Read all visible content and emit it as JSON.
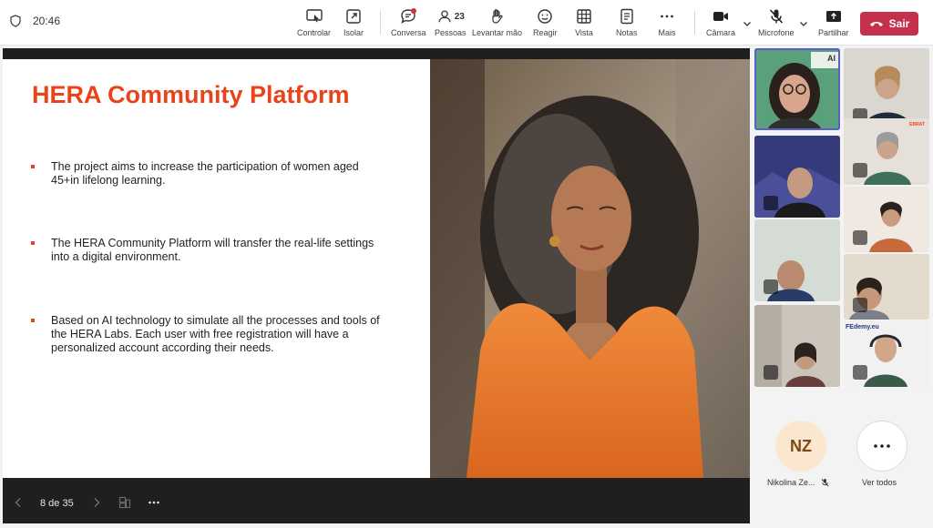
{
  "header": {
    "time": "20:46",
    "buttons": [
      {
        "label": "Controlar",
        "icon": "share-control-icon"
      },
      {
        "label": "Isolar",
        "icon": "pop-out-icon"
      },
      {
        "label": "Conversa",
        "icon": "chat-icon"
      },
      {
        "label": "Pessoas",
        "icon": "people-icon"
      },
      {
        "label": "Levantar mão",
        "icon": "raise-hand-icon"
      },
      {
        "label": "Reagir",
        "icon": "react-icon"
      },
      {
        "label": "Vista",
        "icon": "view-icon"
      },
      {
        "label": "Notas",
        "icon": "notes-icon"
      },
      {
        "label": "Mais",
        "icon": "more-icon"
      },
      {
        "label": "Câmara",
        "icon": "camera-icon"
      },
      {
        "label": "Microfone",
        "icon": "mic-off-icon"
      },
      {
        "label": "Partilhar",
        "icon": "share-icon"
      }
    ],
    "people_count": "23",
    "leave_label": "Sair",
    "colors": {
      "leave": "#c4314b",
      "accent": "#5b5fc7"
    }
  },
  "slide": {
    "title": "HERA Community Platform",
    "bullets": [
      "The project aims to increase the participation of women aged 45+in lifelong learning.",
      "The HERA Community Platform will  transfer the real-life settings into a digital environment.",
      "Based on AI technology to simulate all the processes and tools of the HERA Labs. Each user with free registration will have a personalized account according their needs."
    ],
    "accent_color": "#e8441c"
  },
  "presentation": {
    "page_indicator": "8 de 35"
  },
  "participants": {
    "tile_text": {
      "ai_badge": "AI",
      "ebrat": "EBRAT",
      "fedemy": "FEdemy.eu"
    },
    "nz": {
      "initials": "NZ",
      "name": "Nikolina Ze..."
    },
    "view_all": "Ver todos"
  }
}
